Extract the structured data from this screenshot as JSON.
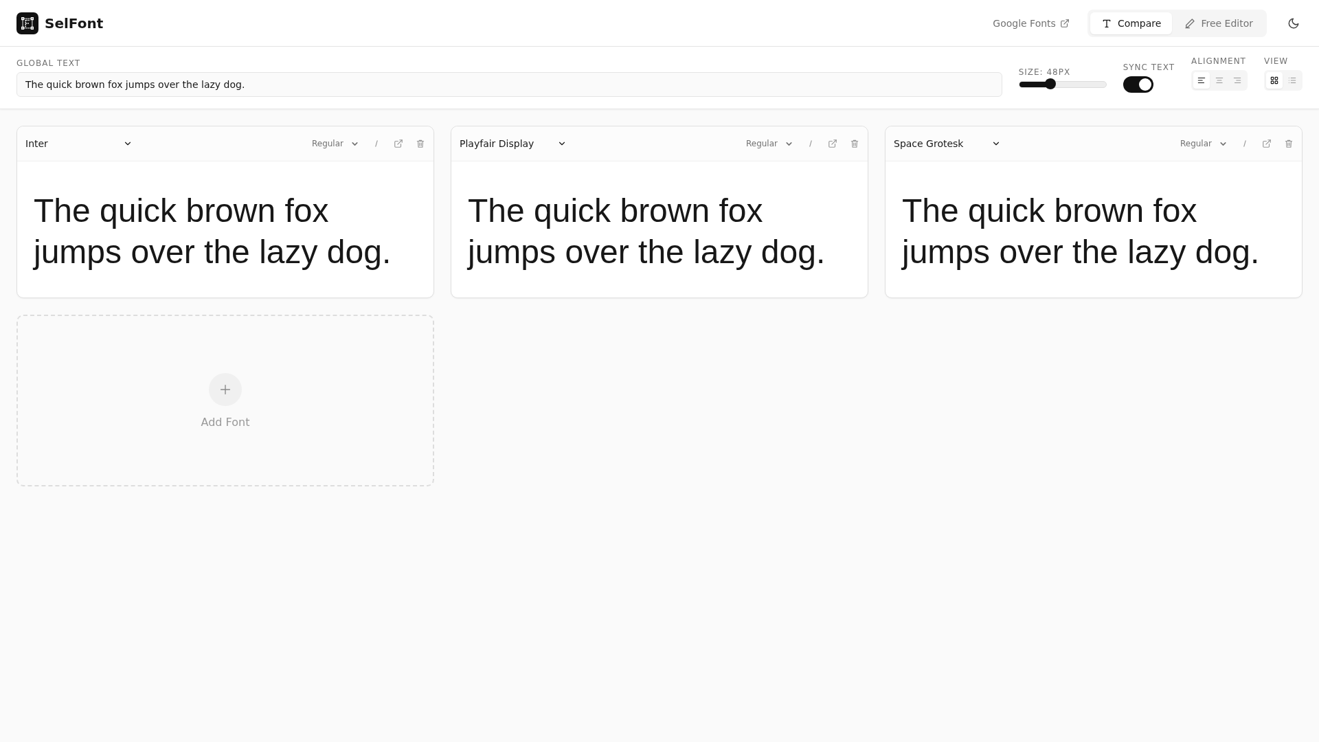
{
  "app": {
    "name": "SelFont"
  },
  "nav": {
    "link": "Google Fonts",
    "modes": [
      {
        "label": "Compare",
        "kind": "type",
        "selected": true
      },
      {
        "label": "Free Editor",
        "kind": "pencil",
        "selected": false
      }
    ]
  },
  "controls": {
    "global_text": {
      "label": "GLOBAL TEXT",
      "value": "The quick brown fox jumps over the lazy dog."
    },
    "size": {
      "label": "SIZE: 48PX",
      "level": 0.36
    },
    "sync": {
      "label": "SYNC TEXT",
      "on": true
    },
    "alignment": {
      "label": "ALIGNMENT",
      "options": [
        {
          "kind": "left",
          "selected": true
        },
        {
          "kind": "center",
          "selected": false
        },
        {
          "kind": "right",
          "selected": false
        }
      ]
    },
    "view": {
      "label": "VIEW",
      "options": [
        {
          "kind": "grid",
          "selected": true
        },
        {
          "kind": "list",
          "selected": false
        }
      ]
    }
  },
  "cards": [
    {
      "font": "Inter",
      "weight": "Regular",
      "preview": "The quick brown fox jumps over the lazy dog."
    },
    {
      "font": "Playfair Display",
      "weight": "Regular",
      "preview": "The quick brown fox jumps over the lazy dog."
    },
    {
      "font": "Space Grotesk",
      "weight": "Regular",
      "preview": "The quick brown fox jumps over the lazy dog."
    }
  ],
  "add_card": {
    "label": "Add Font"
  }
}
